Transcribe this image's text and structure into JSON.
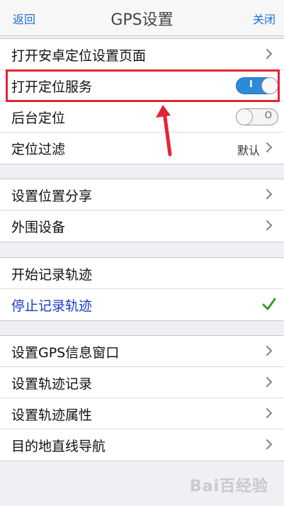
{
  "nav": {
    "back_label": "返回",
    "title": "GPS设置",
    "close_label": "关闭"
  },
  "groups": [
    {
      "items": [
        {
          "label": "打开安卓定位设置页面",
          "accessory": "chevron"
        },
        {
          "label": "打开定位服务",
          "accessory": "toggle",
          "toggle_on": true,
          "toggle_glyph": "I"
        },
        {
          "label": "后台定位",
          "accessory": "toggle",
          "toggle_on": false,
          "toggle_glyph": "O"
        },
        {
          "label": "定位过滤",
          "accessory": "value-chevron",
          "value": "默认"
        }
      ]
    },
    {
      "items": [
        {
          "label": "设置位置分享",
          "accessory": "chevron"
        },
        {
          "label": "外围设备",
          "accessory": "chevron"
        }
      ]
    },
    {
      "items": [
        {
          "label": "开始记录轨迹",
          "accessory": "none"
        },
        {
          "label": "停止记录轨迹",
          "accessory": "checkmark",
          "selected": true
        }
      ]
    },
    {
      "items": [
        {
          "label": "设置GPS信息窗口",
          "accessory": "chevron"
        },
        {
          "label": "设置轨迹记录",
          "accessory": "chevron"
        },
        {
          "label": "设置轨迹属性",
          "accessory": "chevron"
        },
        {
          "label": "目的地直线导航",
          "accessory": "chevron"
        }
      ]
    }
  ],
  "annotation": {
    "highlight_color": "#e32434",
    "arrow_color": "#e32434"
  },
  "watermark": "Bai百经验",
  "colors": {
    "accent": "#1a6fd1",
    "selected_text": "#1a39c8",
    "toggle_on": "#2d8ad8",
    "check": "#3a9a2a"
  }
}
